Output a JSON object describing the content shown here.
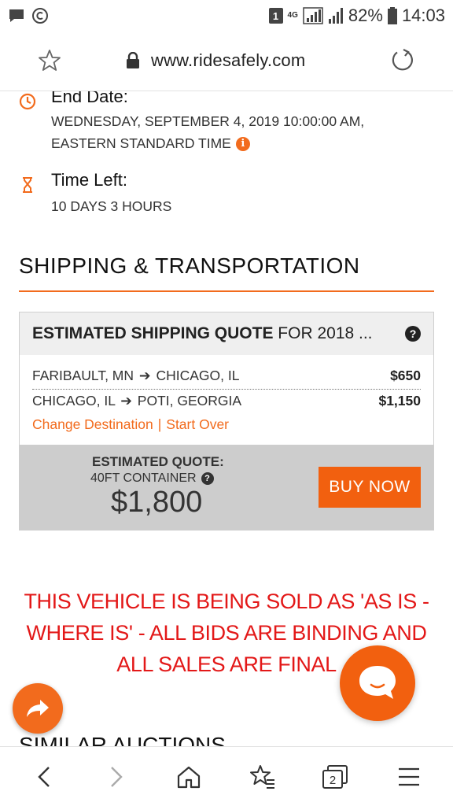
{
  "status_bar": {
    "sim_slot": "1",
    "network": "4G",
    "battery_percent": "82%",
    "time": "14:03"
  },
  "browser": {
    "url": "www.ridesafely.com"
  },
  "auction": {
    "end_date_title": "End Date:",
    "end_date_line1": "WEDNESDAY, SEPTEMBER 4, 2019 10:00:00 AM,",
    "end_date_line2": "EASTERN STANDARD TIME",
    "time_left_title": "Time Left:",
    "time_left_value": "10 DAYS 3 HOURS"
  },
  "shipping": {
    "section_title": "SHIPPING & TRANSPORTATION",
    "quote_header_bold": "ESTIMATED SHIPPING QUOTE",
    "quote_header_rest": " FOR 2018 ...",
    "routes": [
      {
        "from": "FARIBAULT, MN",
        "to": "CHICAGO, IL",
        "price": "$650"
      },
      {
        "from": "CHICAGO, IL",
        "to": "POTI, GEORGIA",
        "price": "$1,150"
      }
    ],
    "change_destination": "Change Destination",
    "link_separator": "|",
    "start_over": "Start Over",
    "estimated_quote_label": "ESTIMATED QUOTE:",
    "container": "40FT CONTAINER",
    "total": "$1,800",
    "buy_now": "BUY NOW"
  },
  "warning": {
    "text": "THIS VEHICLE IS BEING SOLD AS 'AS IS - WHERE IS' - ALL BIDS ARE BINDING AND ALL SALES ARE FINAL"
  },
  "similar_auctions": {
    "title": "SIMILAR AUCTIONS"
  },
  "bottom_nav": {
    "tab_count": "2"
  },
  "colors": {
    "accent": "#f26b1d",
    "warning": "#e31818",
    "footer_gray": "#cdcdcd"
  }
}
